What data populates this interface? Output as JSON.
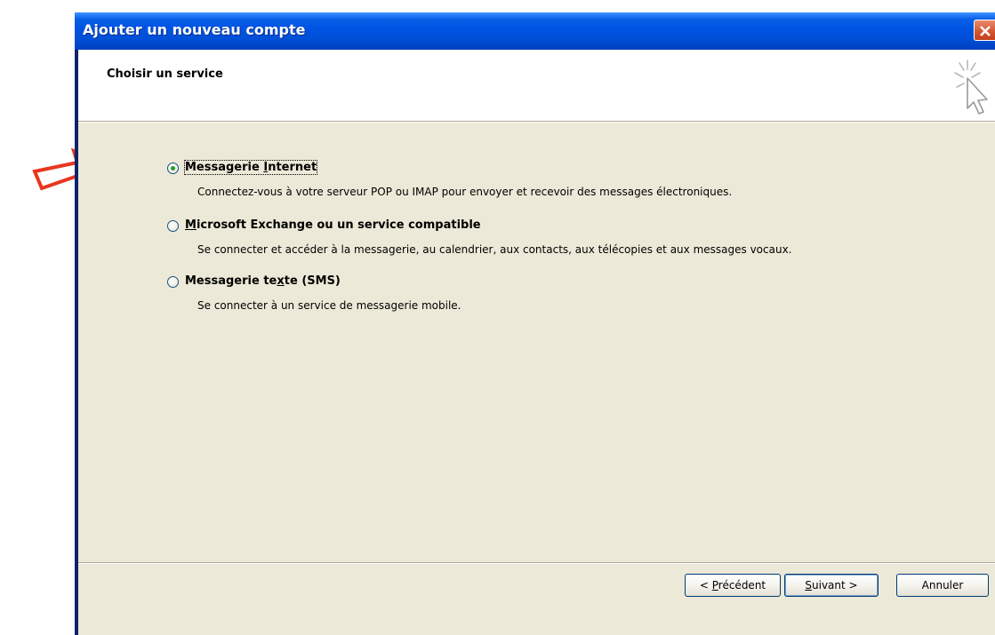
{
  "window": {
    "title": "Ajouter un nouveau compte"
  },
  "header": {
    "heading": "Choisir un service",
    "icon": "wizard-sparkle-cursor-icon"
  },
  "options": [
    {
      "label_pre": "Messagerie ",
      "label_mn": "I",
      "label_post": "nternet",
      "description": "Connectez-vous à votre serveur POP ou IMAP pour envoyer et recevoir des messages électroniques.",
      "selected": true
    },
    {
      "label_pre": "",
      "label_mn": "M",
      "label_post": "icrosoft Exchange ou un service compatible",
      "description": "Se connecter et accéder à la messagerie, au calendrier, aux contacts, aux télécopies et aux messages vocaux.",
      "selected": false
    },
    {
      "label_pre": "Messagerie te",
      "label_mn": "x",
      "label_post": "te (SMS)",
      "description": "Se connecter à un service de messagerie mobile.",
      "selected": false
    }
  ],
  "buttons": {
    "back": {
      "pre": "< ",
      "mn": "P",
      "post": "récédent"
    },
    "next": {
      "pre": "",
      "mn": "S",
      "post": "uivant >"
    },
    "cancel": "Annuler"
  },
  "colors": {
    "annotation_arrow": "#e8361f",
    "titlebar": "#0054e3",
    "dialog_background": "#ece9d8",
    "radio_selected_dot": "#21a121"
  }
}
